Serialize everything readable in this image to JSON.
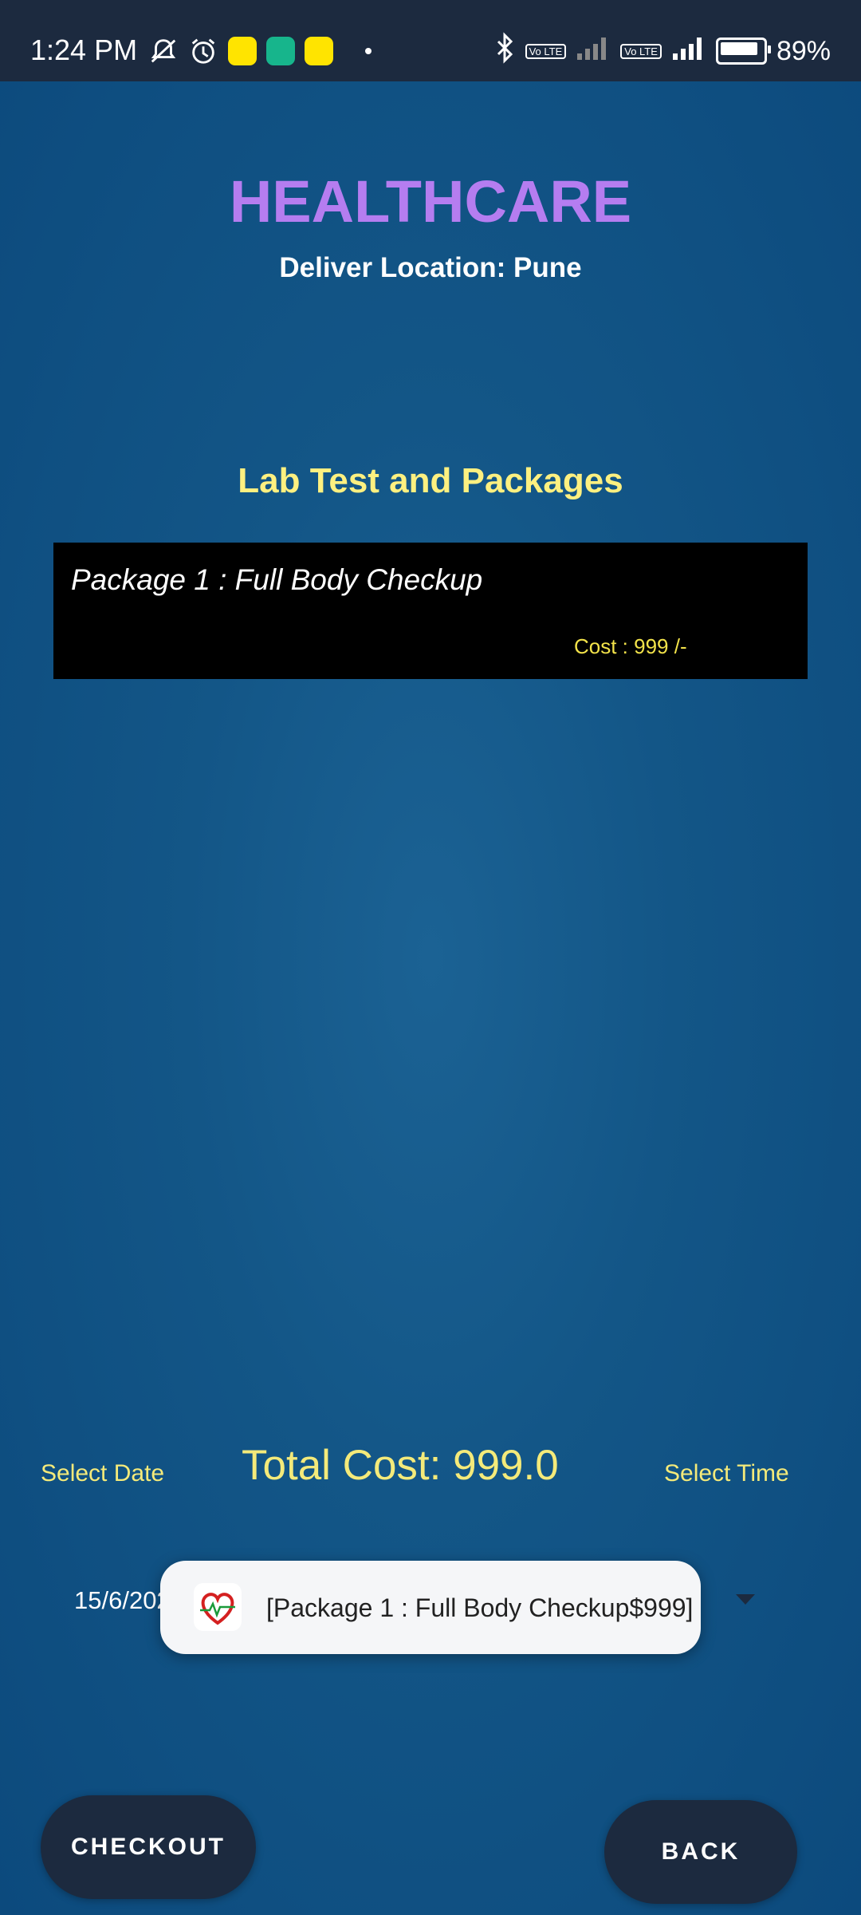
{
  "status_bar": {
    "time": "1:24 PM",
    "battery": "89%",
    "lte_1": "Vo LTE",
    "lte_2": "Vo LTE"
  },
  "header": {
    "title": "HEALTHCARE",
    "location": "Deliver Location: Pune"
  },
  "section_title": "Lab Test and Packages",
  "packages": [
    {
      "name": "Package 1 : Full Body Checkup",
      "cost": "Cost : 999 /-"
    }
  ],
  "footer": {
    "select_date_label": "Select Date",
    "total_cost": "Total Cost: 999.0",
    "select_time_label": "Select Time",
    "date_value": "15/6/2023"
  },
  "toast": {
    "message": "[Package 1 : Full Body Checkup$999]"
  },
  "buttons": {
    "checkout": "CHECKOUT",
    "back": "BACK"
  },
  "colors": {
    "title": "#b57df0",
    "accent_yellow": "#f4ea7a",
    "background": "#135687",
    "button": "#1c2a3f"
  }
}
